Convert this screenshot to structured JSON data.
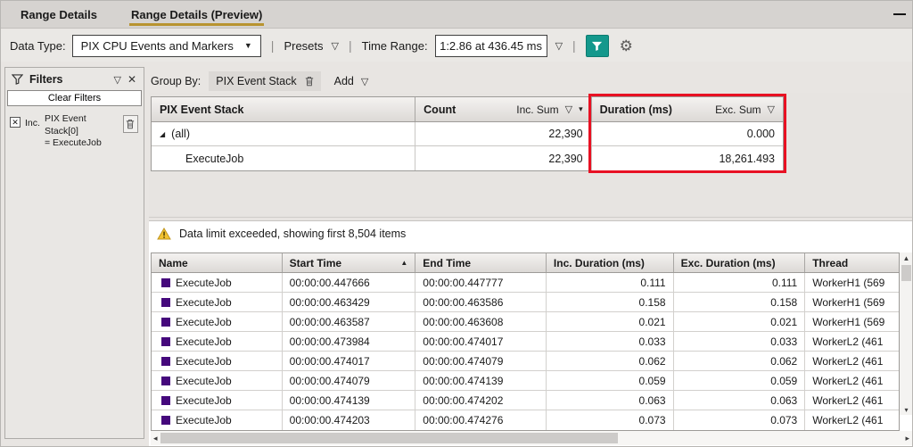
{
  "tabs": {
    "items": [
      {
        "label": "Range Details"
      },
      {
        "label": "Range Details (Preview)"
      }
    ]
  },
  "toolbar": {
    "data_type_label": "Data Type:",
    "data_type_value": "PIX CPU Events and Markers",
    "presets_label": "Presets",
    "time_range_label": "Time Range:",
    "time_range_value": "1:2.86 at 436.45 ms",
    "accent_teal": "#14988c"
  },
  "filters_panel": {
    "title": "Filters",
    "clear_filters_label": "Clear Filters",
    "filter_mode": "Inc.",
    "filter_line1": "PIX Event Stack[0]",
    "filter_line2": "= ExecuteJob"
  },
  "group_by": {
    "label": "Group By:",
    "chip_label": "PIX Event Stack",
    "add_label": "Add"
  },
  "summary_table": {
    "col1_title": "PIX Event Stack",
    "col2_title": "Count",
    "col2_agg": "Inc. Sum",
    "col3_title": "Duration (ms)",
    "col3_agg": "Exc. Sum",
    "highlight_color": "#e81123",
    "rows": [
      {
        "label": "(all)",
        "count": "22,390",
        "duration": "0.000"
      },
      {
        "label": "ExecuteJob",
        "count": "22,390",
        "duration": "18,261.493"
      }
    ]
  },
  "warning_bar": {
    "text": "Data limit exceeded, showing first 8,504 items"
  },
  "events_table": {
    "marker_color": "#45087c",
    "headers": {
      "name": "Name",
      "start": "Start Time",
      "end": "End Time",
      "inc": "Inc. Duration (ms)",
      "exc": "Exc. Duration (ms)",
      "thread": "Thread"
    },
    "rows": [
      {
        "name": "ExecuteJob",
        "start": "00:00:00.447666",
        "end": "00:00:00.447777",
        "inc": "0.111",
        "exc": "0.111",
        "thread": "WorkerH1 (569"
      },
      {
        "name": "ExecuteJob",
        "start": "00:00:00.463429",
        "end": "00:00:00.463586",
        "inc": "0.158",
        "exc": "0.158",
        "thread": "WorkerH1 (569"
      },
      {
        "name": "ExecuteJob",
        "start": "00:00:00.463587",
        "end": "00:00:00.463608",
        "inc": "0.021",
        "exc": "0.021",
        "thread": "WorkerH1 (569"
      },
      {
        "name": "ExecuteJob",
        "start": "00:00:00.473984",
        "end": "00:00:00.474017",
        "inc": "0.033",
        "exc": "0.033",
        "thread": "WorkerL2 (461"
      },
      {
        "name": "ExecuteJob",
        "start": "00:00:00.474017",
        "end": "00:00:00.474079",
        "inc": "0.062",
        "exc": "0.062",
        "thread": "WorkerL2 (461"
      },
      {
        "name": "ExecuteJob",
        "start": "00:00:00.474079",
        "end": "00:00:00.474139",
        "inc": "0.059",
        "exc": "0.059",
        "thread": "WorkerL2 (461"
      },
      {
        "name": "ExecuteJob",
        "start": "00:00:00.474139",
        "end": "00:00:00.474202",
        "inc": "0.063",
        "exc": "0.063",
        "thread": "WorkerL2 (461"
      },
      {
        "name": "ExecuteJob",
        "start": "00:00:00.474203",
        "end": "00:00:00.474276",
        "inc": "0.073",
        "exc": "0.073",
        "thread": "WorkerL2 (461"
      }
    ]
  },
  "icons": {
    "dropdown_outline": "▽",
    "dropdown_filled": "▼",
    "dropdown_small": "▾",
    "sort_asc": "▲",
    "close": "✕",
    "check": "✕",
    "gear": "⚙",
    "expander_expanded": "◢",
    "scroll_up": "▲",
    "scroll_down": "▾",
    "scroll_left": "◂",
    "scroll_right": "▸"
  }
}
